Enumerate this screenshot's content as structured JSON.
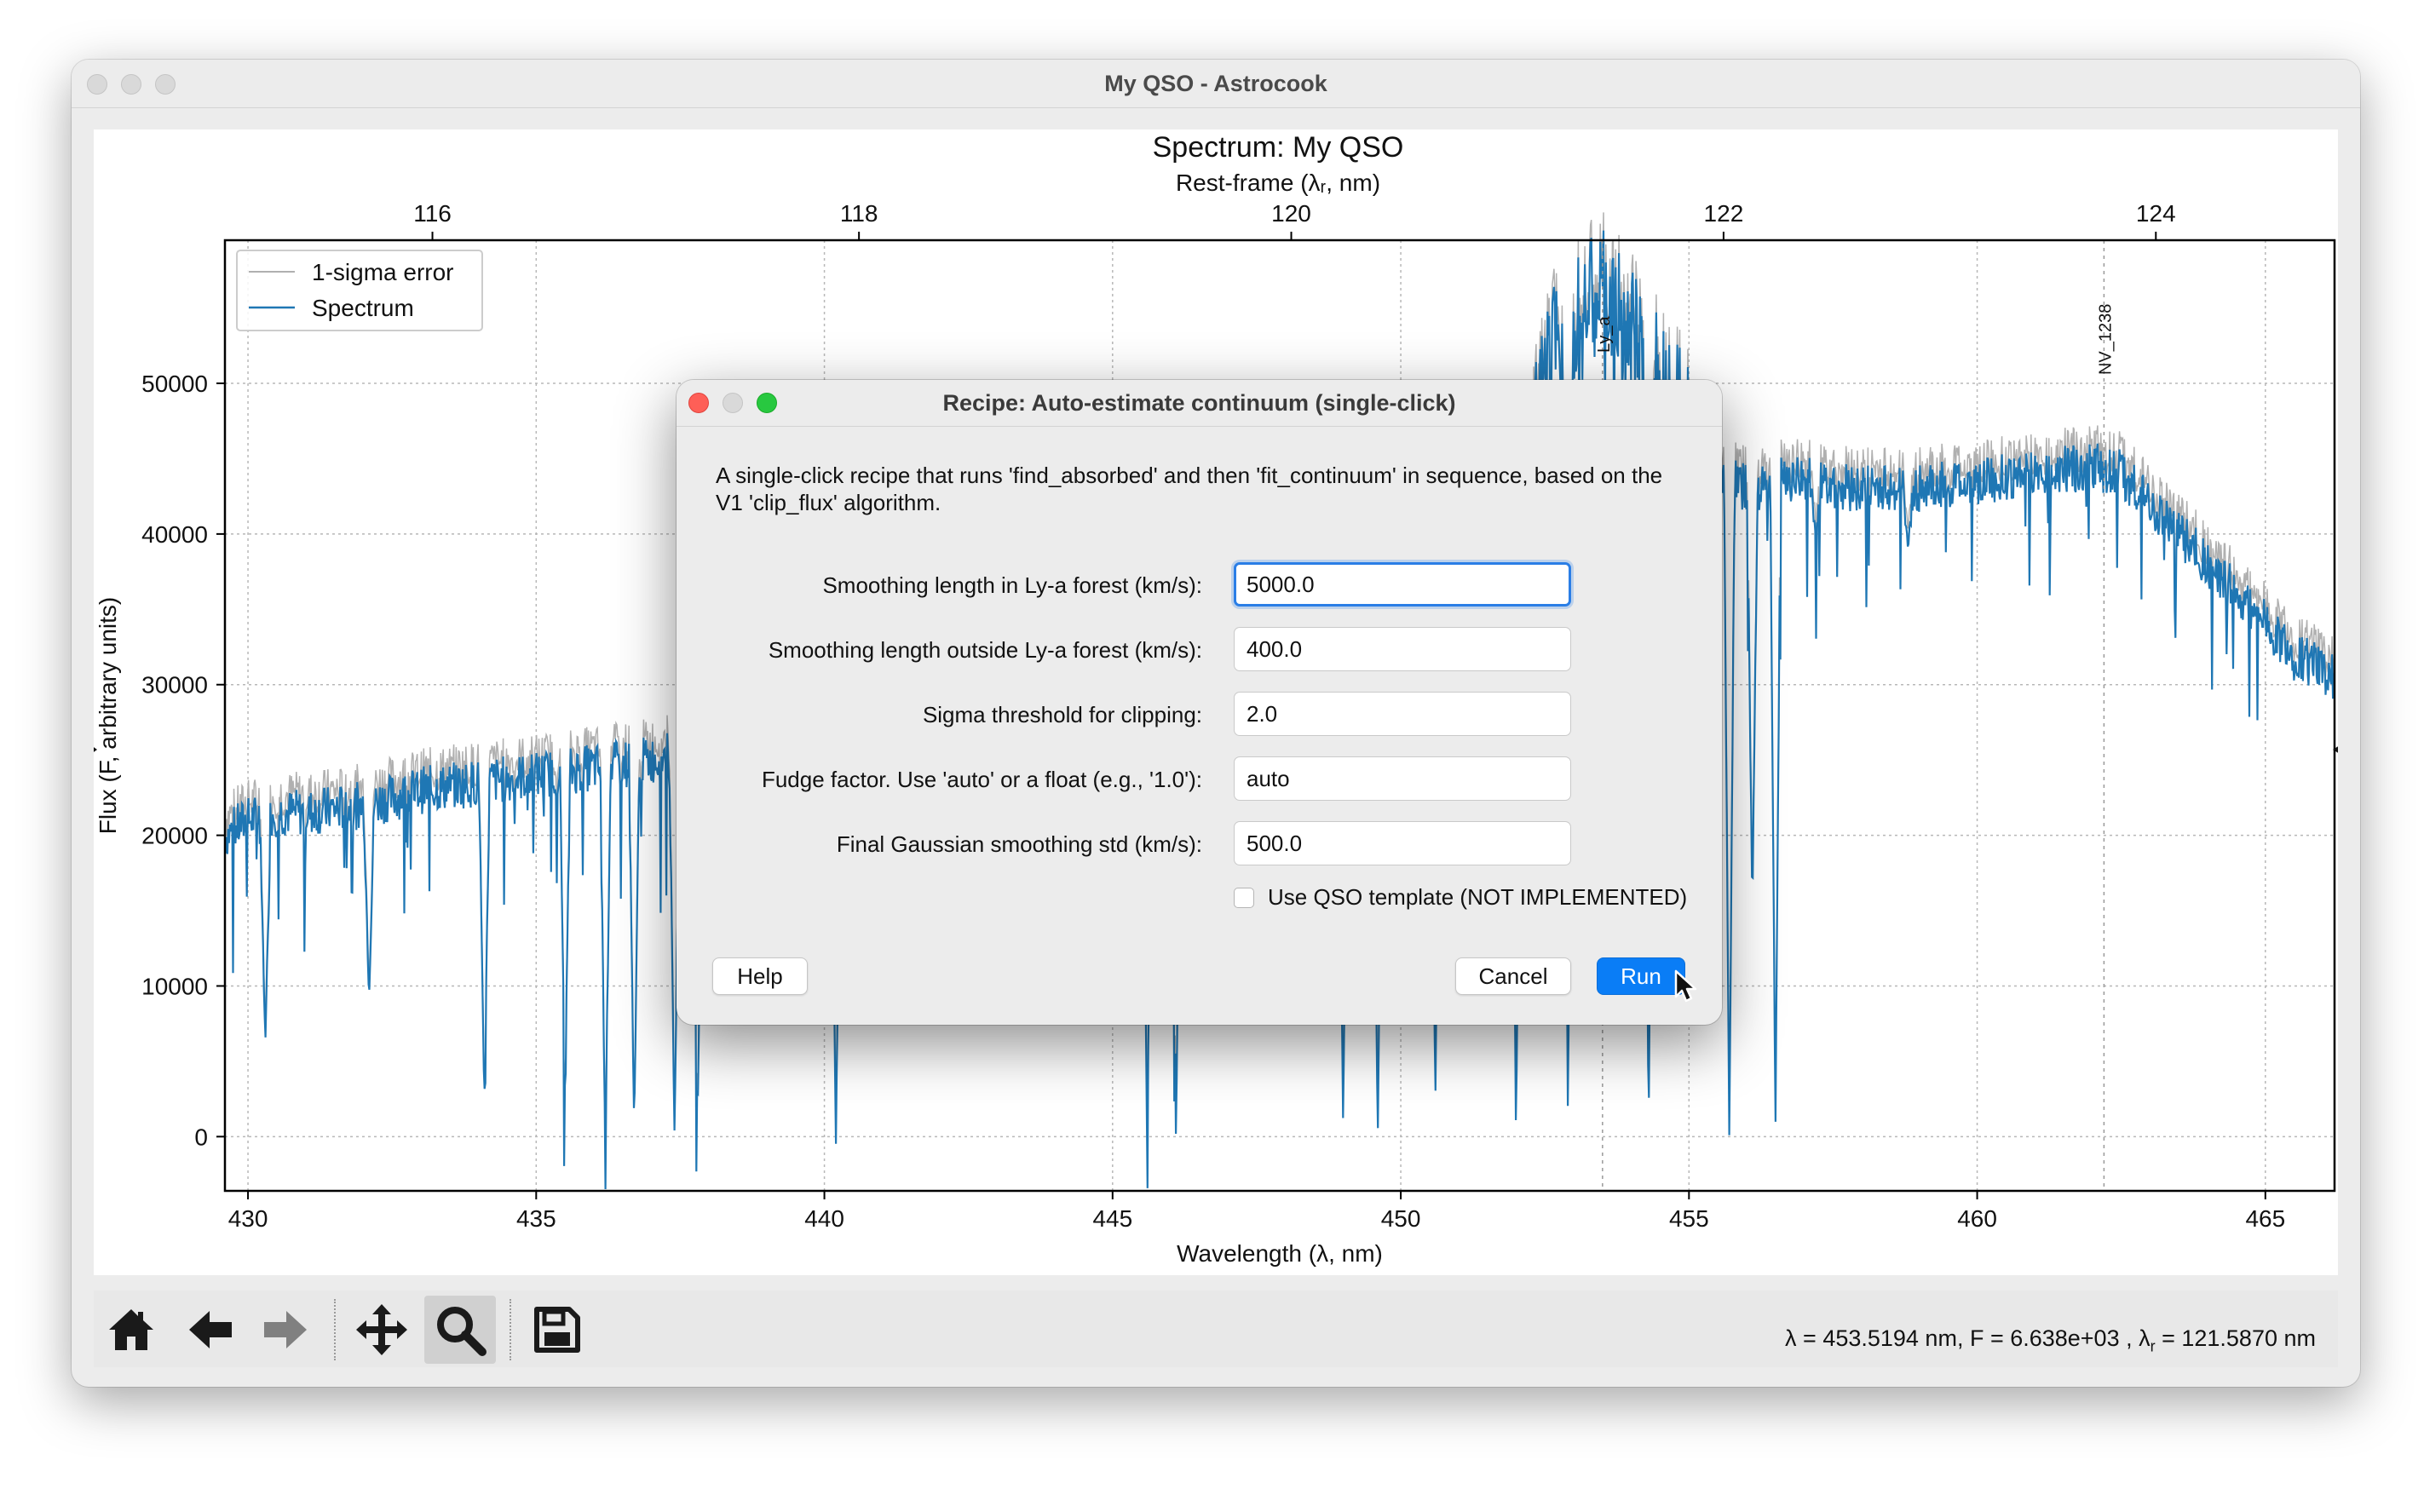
{
  "window": {
    "title": "My QSO - Astrocook"
  },
  "chart_data": {
    "type": "line",
    "title": "Spectrum: My QSO",
    "xlabel": "Wavelength (λ, nm)",
    "ylabel": "Flux (F, arbitrary units)",
    "x2label": "Rest-frame (λᵣ, nm)",
    "xlim": [
      429.6,
      466.2
    ],
    "ylim": [
      -3600,
      59500
    ],
    "x_ticks": [
      430,
      435,
      440,
      445,
      450,
      455,
      460,
      465
    ],
    "y_ticks": [
      0,
      10000,
      20000,
      30000,
      40000,
      50000
    ],
    "x2_ticks": [
      116,
      118,
      120,
      122,
      124
    ],
    "x2_ticks_at_x": [
      433.2,
      440.6,
      448.1,
      455.6,
      463.1
    ],
    "grid": true,
    "legend_position": "top-left",
    "series": [
      {
        "name": "1-sigma error",
        "color": "#b0b0b0"
      },
      {
        "name": "Spectrum",
        "color": "#1f77b4",
        "x": [
          429.6,
          430.0,
          430.5,
          431.0,
          432.0,
          433.0,
          434.0,
          435.0,
          436.0,
          437.0,
          438.0,
          439.0,
          440.0,
          441.0,
          442.0,
          443.0,
          444.0,
          445.0,
          446.0,
          447.0,
          448.0,
          449.0,
          450.0,
          451.0,
          452.0,
          452.6,
          453.0,
          453.5,
          454.0,
          454.5,
          455.0,
          455.5,
          456.0,
          456.5,
          457.0,
          458.0,
          459.0,
          460.0,
          461.0,
          462.0,
          462.5,
          463.0,
          463.5,
          464.0,
          464.5,
          465.0,
          465.5,
          466.2
        ],
        "y": [
          20000,
          21000,
          21500,
          21500,
          22000,
          23000,
          23500,
          24000,
          24500,
          25000,
          26000,
          27000,
          28000,
          28500,
          29000,
          29500,
          30000,
          31000,
          32000,
          33000,
          34000,
          35000,
          36000,
          37500,
          40000,
          52000,
          54000,
          56000,
          53000,
          51000,
          47000,
          44000,
          43000,
          44000,
          43500,
          43000,
          43000,
          43500,
          44000,
          44500,
          44000,
          42000,
          40000,
          38000,
          36000,
          34000,
          32000,
          30500
        ]
      }
    ],
    "absorption_lines": [
      {
        "x": 430.3,
        "depth_to": 6000
      },
      {
        "x": 432.1,
        "depth_to": 9000
      },
      {
        "x": 434.1,
        "depth_to": 2000
      },
      {
        "x": 435.5,
        "depth_to": 3000
      },
      {
        "x": 436.2,
        "depth_to": -1000
      },
      {
        "x": 436.7,
        "depth_to": 500
      },
      {
        "x": 437.4,
        "depth_to": 0
      },
      {
        "x": 437.8,
        "depth_to": 1000
      },
      {
        "x": 440.2,
        "depth_to": -500
      },
      {
        "x": 441.3,
        "depth_to": 8000
      },
      {
        "x": 445.6,
        "depth_to": -800
      },
      {
        "x": 446.1,
        "depth_to": -500
      },
      {
        "x": 449.0,
        "depth_to": 500
      },
      {
        "x": 449.6,
        "depth_to": -800
      },
      {
        "x": 450.6,
        "depth_to": 2000
      },
      {
        "x": 452.0,
        "depth_to": -500
      },
      {
        "x": 452.9,
        "depth_to": 500
      },
      {
        "x": 454.3,
        "depth_to": -500
      },
      {
        "x": 455.7,
        "depth_to": -600
      },
      {
        "x": 456.1,
        "depth_to": 15000
      },
      {
        "x": 456.5,
        "depth_to": 500
      },
      {
        "x": 457.2,
        "depth_to": 40000
      },
      {
        "x": 458.8,
        "depth_to": 39000
      }
    ],
    "line_markers": [
      {
        "label": "Ly_a",
        "x": 453.5
      },
      {
        "label": "NV_1238",
        "x": 462.2
      }
    ]
  },
  "toolbar": {
    "home": "home-icon",
    "back": "arrow-left-icon",
    "forward": "arrow-right-icon",
    "pan": "move-icon",
    "zoom": "magnifier-icon",
    "save": "floppy-disk-icon"
  },
  "status": {
    "prefix": "λ = 453.5194 nm, F = 6.638e+03 , λ",
    "sub": "r",
    "suffix": " = 121.5870 nm"
  },
  "dialog": {
    "title": "Recipe: Auto-estimate continuum (single-click)",
    "description": "A single-click recipe that runs 'find_absorbed' and then 'fit_continuum' in sequence, based on the V1 'clip_flux' algorithm.",
    "fields": [
      {
        "label": "Smoothing length in Ly-a forest (km/s):",
        "value": "5000.0"
      },
      {
        "label": "Smoothing length outside Ly-a forest (km/s):",
        "value": "400.0"
      },
      {
        "label": "Sigma threshold for clipping:",
        "value": "2.0"
      },
      {
        "label": "Fudge factor. Use 'auto' or a float (e.g., '1.0'):",
        "value": "auto"
      },
      {
        "label": "Final Gaussian smoothing std (km/s):",
        "value": "500.0"
      }
    ],
    "checkbox_label": "Use QSO template (NOT IMPLEMENTED)",
    "checkbox_checked": false,
    "help_label": "Help",
    "cancel_label": "Cancel",
    "run_label": "Run"
  }
}
